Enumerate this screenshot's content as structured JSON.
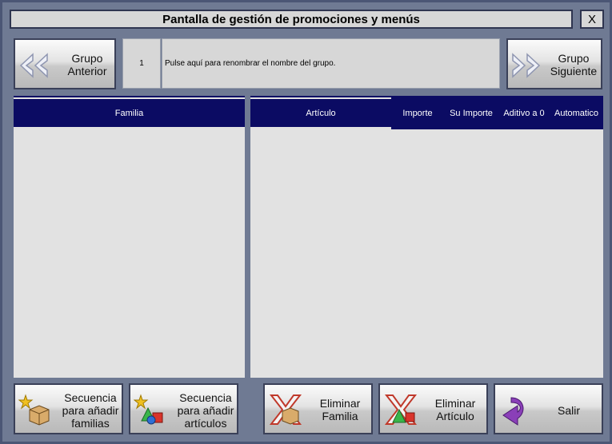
{
  "window": {
    "title": "Pantalla de gestión de promociones y menús",
    "close_label": "X"
  },
  "group": {
    "prev_label_1": "Grupo",
    "prev_label_2": "Anterior",
    "number": "1",
    "name_prompt": "Pulse aquí para renombrar el nombre del grupo.",
    "next_label_1": "Grupo",
    "next_label_2": "Siguiente"
  },
  "family_table": {
    "header": "Familia"
  },
  "article_table": {
    "columns": [
      "Artículo",
      "Importe",
      "Su Importe",
      "Aditivo a 0",
      "Automatico"
    ]
  },
  "buttons": {
    "add_families_1": "Secuencia",
    "add_families_2": "para añadir",
    "add_families_3": "familias",
    "add_articles_1": "Secuencia",
    "add_articles_2": "para añadir",
    "add_articles_3": "artículos",
    "delete_family_1": "Eliminar",
    "delete_family_2": "Familia",
    "delete_article_1": "Eliminar",
    "delete_article_2": "Artículo",
    "exit": "Salir"
  },
  "colors": {
    "header_bg": "#0b0b63",
    "panel_bg": "#e2e2e2",
    "window_bg": "#6f7a93"
  }
}
